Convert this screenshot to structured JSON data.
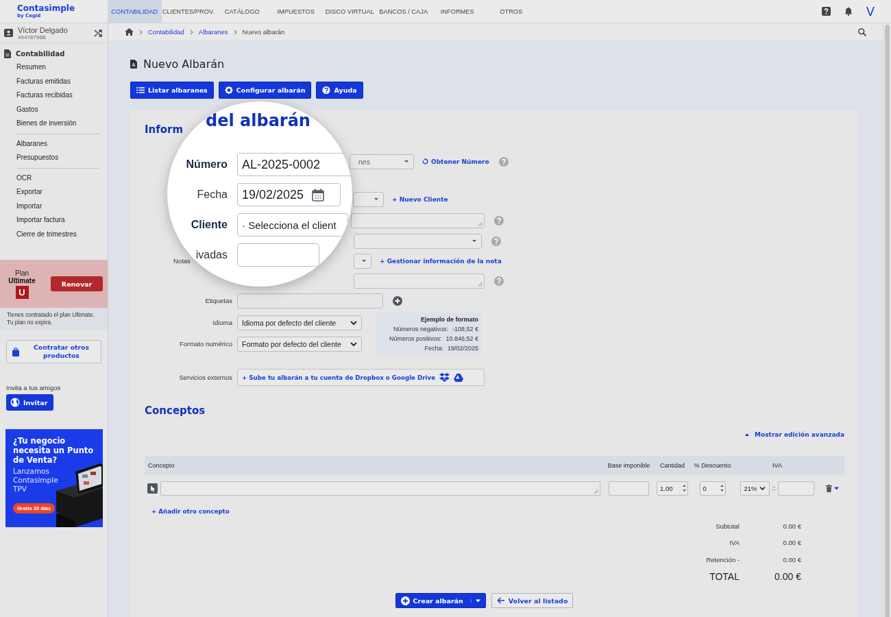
{
  "topbar": {
    "logo": "Contasimple",
    "logo_sub": "by Cegid",
    "avatar_letter": "V",
    "nav": [
      {
        "label": "CONTABILIDAD",
        "selected": true
      },
      {
        "label": "CLIENTES/PROV.",
        "selected": false
      },
      {
        "label": "CATÁLOGO",
        "selected": false
      },
      {
        "label": "IMPUESTOS",
        "selected": false
      },
      {
        "label": "DISCO VIRTUAL",
        "selected": false
      },
      {
        "label": "BANCOS / CAJA",
        "selected": false
      },
      {
        "label": "INFORMES",
        "selected": false
      },
      {
        "label": "OTROS",
        "selected": false
      }
    ]
  },
  "sidebar": {
    "user": {
      "name": "Víctor Delgado",
      "id": "49478796B"
    },
    "section": "Contabilidad",
    "groups": [
      [
        {
          "label": "Resumen",
          "selected": false
        },
        {
          "label": "Facturas emitidas",
          "selected": false
        },
        {
          "label": "Facturas recibidas",
          "selected": false
        },
        {
          "label": "Gastos",
          "selected": false
        },
        {
          "label": "Bienes de inversión",
          "selected": false
        }
      ],
      [
        {
          "label": "Albaranes",
          "selected": false
        },
        {
          "label": "Presupuestos",
          "selected": false
        }
      ],
      [
        {
          "label": "OCR",
          "selected": false
        },
        {
          "label": "Exportar",
          "selected": false
        },
        {
          "label": "Importar",
          "selected": false
        },
        {
          "label": "Importar factura",
          "selected": false
        },
        {
          "label": "Cierre de trimestres",
          "selected": false
        }
      ]
    ],
    "plan": {
      "title": "Plan",
      "name": "Ultimate",
      "badge": "U",
      "button": "Renovar",
      "note": [
        "Tienes contratado el plan Ultimate.",
        "Tu plan no expira."
      ]
    },
    "products_button": "Contratar otros productos",
    "invite": {
      "text": "Invita a tus amigos",
      "button": "Invitar"
    },
    "ad": {
      "headline": "¿Tu negocio necesita un Punto de Venta?",
      "body": "Lanzamos Contasimple TPV",
      "badge": "Gratis 30 días"
    }
  },
  "breadcrumb": {
    "items": [
      "Contabilidad",
      "Albaranes"
    ],
    "current": "Nuevo albarán"
  },
  "page": {
    "title": "Nuevo Albarán",
    "toolbar": [
      {
        "label": "Listar albaranes"
      },
      {
        "label": "Configurar albarán"
      },
      {
        "label": "Ayuda"
      }
    ]
  },
  "form": {
    "title": "Inform",
    "rows": [
      {
        "kind": "select",
        "value": "nes",
        "link": "Obtener Número",
        "help": true
      },
      {
        "kind": "select",
        "link": "+ Nuevo Cliente",
        "help": false
      },
      {
        "kind": "textarea",
        "help": true
      },
      {
        "kind": "select",
        "help": true
      },
      {
        "kind": "select",
        "label": "Notas",
        "link": "+ Gestionar información de la nota",
        "help": false
      },
      {
        "kind": "textarea",
        "help": true
      },
      {
        "kind": "input",
        "label": "Etiquetas",
        "help": false,
        "add": true
      }
    ],
    "format_rows": [
      {
        "label": "Idioma",
        "value": "Idioma por defecto del cliente"
      },
      {
        "label": "Formato numérico",
        "value": "Formato por defecto del cliente"
      }
    ],
    "format_example": {
      "title": "Ejemplo de formato",
      "lines": [
        {
          "label": "Números negativos:",
          "value": "-108,52 €"
        },
        {
          "label": "Números positivos:",
          "value": "10.846,52 €"
        },
        {
          "label": "Fecha:",
          "value": "19/02/2025"
        }
      ]
    },
    "external": {
      "label": "Servicios externos",
      "button": "+ Sube tu albarán a tu cuenta de Dropbox o Google Drive"
    }
  },
  "magnifier": {
    "title": "del albarán",
    "rows": [
      {
        "label": "Número",
        "value": "AL-2025-0002",
        "bold": true,
        "kind": "text"
      },
      {
        "label": "Fecha",
        "value": "19/02/2025",
        "bold": false,
        "kind": "date"
      },
      {
        "label": "Cliente",
        "value": "· Selecciona el client",
        "bold": true,
        "kind": "text"
      },
      {
        "label": "ivadas",
        "bold": false,
        "kind": "text"
      }
    ]
  },
  "concepts": {
    "title": "Conceptos",
    "advanced": "Mostrar edición avanzada",
    "table": {
      "columns": [
        "Concepto",
        "Base imponible",
        "Cantidad",
        "% Descuento",
        "IVA"
      ],
      "rows": [
        {
          "quantity": "1.00",
          "discount": "0",
          "vat": "21%",
          "separator": "::"
        }
      ]
    },
    "add_row": "+ Añadir otro concepto",
    "totals": [
      {
        "label": "Subtotal",
        "value": "0.00 €",
        "kind": "line"
      },
      {
        "label": "IVA",
        "value": "0.00 €",
        "kind": "line"
      },
      {
        "label": "Retención -",
        "value": "0.00 €",
        "kind": "line"
      },
      {
        "label": "TOTAL",
        "value": "0.00 €",
        "kind": "total"
      }
    ]
  },
  "actions": [
    {
      "label": "Crear albarán",
      "kind": "primary"
    },
    {
      "label": "Volver al listado",
      "kind": "secondary"
    }
  ]
}
